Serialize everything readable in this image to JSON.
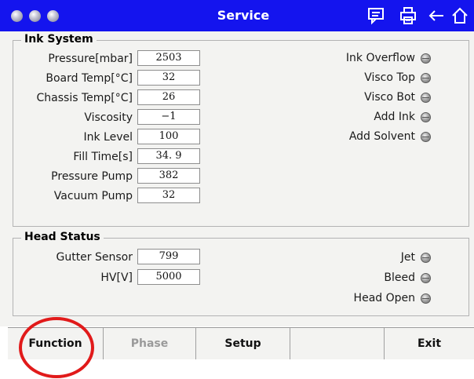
{
  "titlebar": {
    "title": "Service",
    "icons": [
      "message-icon",
      "print-icon",
      "back-arrow-icon",
      "home-icon"
    ],
    "background": "#1414ee"
  },
  "ink_system": {
    "legend": "Ink System",
    "fields": [
      {
        "label": "Pressure[mbar]",
        "value": "2503"
      },
      {
        "label": "Board Temp[°C]",
        "value": "32"
      },
      {
        "label": "Chassis Temp[°C]",
        "value": "26"
      },
      {
        "label": "Viscosity",
        "value": "−1"
      },
      {
        "label": "Ink Level",
        "value": "100"
      },
      {
        "label": "Fill Time[s]",
        "value": "34. 9"
      },
      {
        "label": "Pressure Pump",
        "value": "382"
      },
      {
        "label": "Vacuum Pump",
        "value": "32"
      }
    ],
    "indicators": [
      {
        "label": "Ink Overflow"
      },
      {
        "label": "Visco Top"
      },
      {
        "label": "Visco Bot"
      },
      {
        "label": "Add Ink"
      },
      {
        "label": "Add Solvent"
      }
    ]
  },
  "head_status": {
    "legend": "Head Status",
    "fields": [
      {
        "label": "Gutter Sensor",
        "value": "799"
      },
      {
        "label": "HV[V]",
        "value": "5000"
      }
    ],
    "indicators": [
      {
        "label": "Jet"
      },
      {
        "label": "Bleed"
      },
      {
        "label": "Head Open"
      }
    ]
  },
  "tabs": [
    {
      "label": "Function",
      "enabled": true
    },
    {
      "label": "Phase",
      "enabled": false
    },
    {
      "label": "Setup",
      "enabled": true
    },
    {
      "label": "",
      "enabled": true
    },
    {
      "label": "Exit",
      "enabled": true
    }
  ],
  "highlight_color": "#e11a1a"
}
